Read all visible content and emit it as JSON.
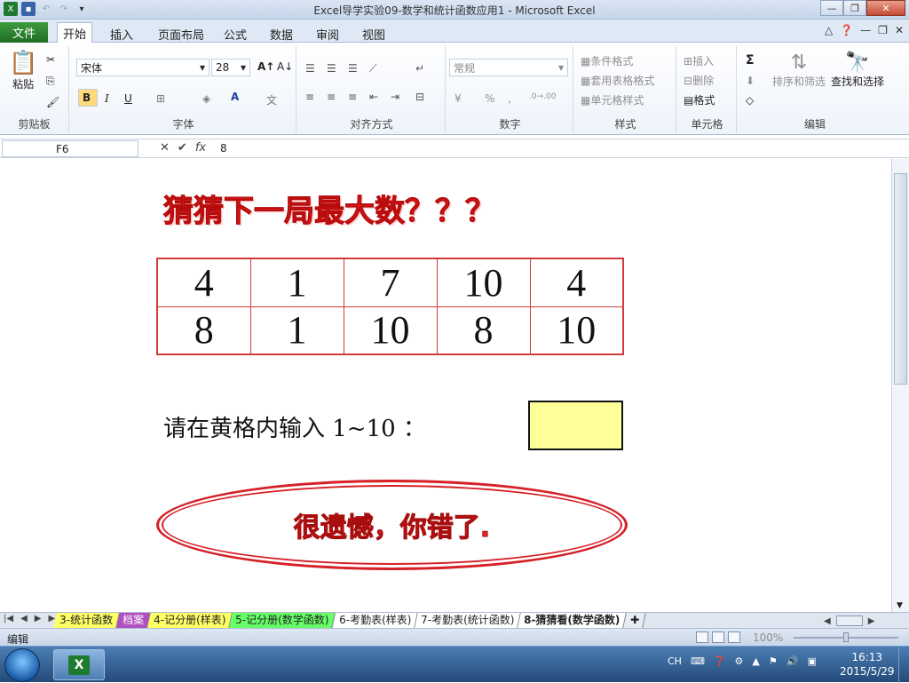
{
  "window": {
    "title": "Excel导学实验09-数学和统计函数应用1  -  Microsoft Excel"
  },
  "ribbon_tabs": {
    "file": "文件",
    "home": "开始",
    "insert": "插入",
    "layout": "页面布局",
    "formulas": "公式",
    "data": "数据",
    "review": "审阅",
    "view": "视图"
  },
  "clipboard": {
    "paste": "粘贴",
    "label": "剪贴板"
  },
  "font": {
    "name": "宋体",
    "size": "28",
    "bold": "B",
    "italic": "I",
    "underline": "U",
    "label": "字体"
  },
  "alignment": {
    "label": "对齐方式"
  },
  "number": {
    "format": "常规",
    "percent": "%",
    "comma": ",",
    "label": "数字"
  },
  "styles": {
    "conditional": "条件格式",
    "table": "套用表格格式",
    "cell": "单元格样式",
    "label": "样式"
  },
  "cells": {
    "insert": "插入",
    "delete": "删除",
    "format": "格式",
    "label": "单元格"
  },
  "editing": {
    "sum": "Σ",
    "sort": "排序和筛选",
    "find": "查找和选择",
    "label": "编辑"
  },
  "formula_bar": {
    "cell_ref": "F6",
    "value": "8",
    "fx": "fx"
  },
  "sheet": {
    "banner": "猜猜下一局最大数？？？",
    "grid": [
      [
        "4",
        "1",
        "7",
        "10",
        "4"
      ],
      [
        "8",
        "1",
        "10",
        "8",
        "10"
      ]
    ],
    "prompt": "请在黄格内输入 1~10 ：",
    "input_value": "",
    "result": "很遗憾，你错了."
  },
  "sheet_tabs": [
    "3-统计函数",
    "档案",
    "4-记分册(样表)",
    "5-记分册(数学函数)",
    "6-考勤表(样表)",
    "7-考勤表(统计函数)",
    "8-猜猜看(数学函数)"
  ],
  "sheet_tab_colors": [
    "#ffff66",
    "#b050c0",
    "#ffff66",
    "#66ff66",
    "#ffffff",
    "#ffffff",
    "#ffffff"
  ],
  "status": {
    "mode": "编辑",
    "zoom": "100%"
  },
  "taskbar": {
    "lang": "CH",
    "time": "16:13",
    "date": "2015/5/29"
  }
}
